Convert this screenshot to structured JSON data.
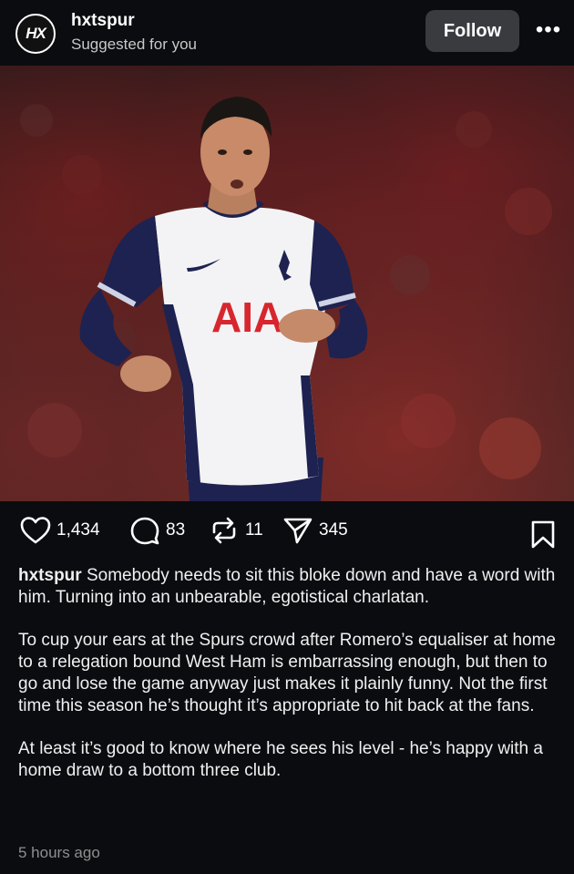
{
  "post": {
    "author": {
      "avatar_text": "HX",
      "username": "hxtspur",
      "subtitle": "Suggested for you"
    },
    "follow_label": "Follow",
    "more_label": "•••",
    "image": {
      "shirt_sponsor": "AIA"
    },
    "actions": {
      "likes": "1,434",
      "comments": "83",
      "reposts": "11",
      "shares": "345"
    },
    "caption": {
      "username": "hxtspur",
      "paragraph_1": "Somebody needs to sit this bloke down and have a word with him. Turning into an unbearable, egotistical charlatan.",
      "paragraph_2": "To cup your ears at the Spurs crowd after Romero’s equaliser at home to a relegation bound West Ham is embarrassing enough, but then to go and lose the game anyway just makes it plainly funny. Not the first time this season he’s thought it’s appropriate to hit back at the fans.",
      "paragraph_3": "At least it’s good to know where he sees his level - he’s happy with a home draw to a bottom three club."
    },
    "timestamp": "5 hours ago"
  },
  "colors": {
    "background": "#0b0c10",
    "follow_button": "#3a3b3f",
    "timestamp": "#8e8e8e",
    "shirt_navy": "#1d2250",
    "sponsor_red": "#d8262e"
  },
  "icons": [
    "heart-icon",
    "comment-icon",
    "repost-icon",
    "share-icon",
    "bookmark-icon",
    "more-icon"
  ]
}
